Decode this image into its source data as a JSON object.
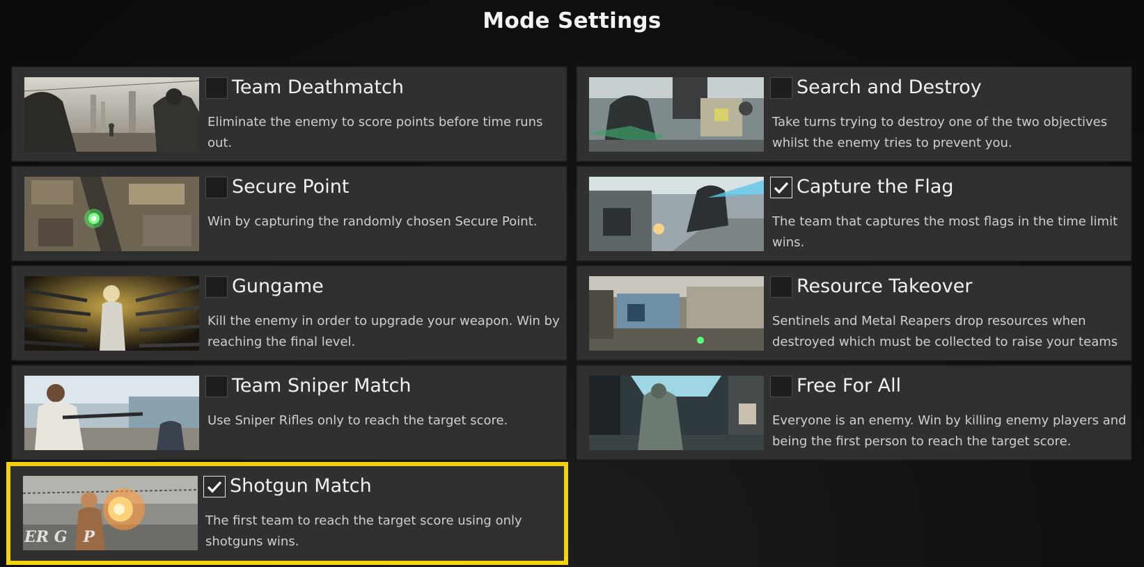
{
  "header": {
    "title": "Mode Settings"
  },
  "colors": {
    "card_bg": "#303030",
    "selected_outline": "#f3d20e",
    "text": "#f2f2f2"
  },
  "modes": [
    {
      "name": "Team Deathmatch",
      "description": "Eliminate the enemy to score points before time runs out.",
      "checked": false,
      "selected": false,
      "thumbnail": "soldiers-in-city-street-image"
    },
    {
      "name": "Search and Destroy",
      "description": "Take turns trying to destroy one of the two objectives whilst the enemy tries to prevent you.",
      "checked": false,
      "selected": false,
      "thumbnail": "armored-soldier-indoors-image"
    },
    {
      "name": "Secure Point",
      "description": "Win by capturing the randomly chosen Secure Point.",
      "checked": false,
      "selected": false,
      "thumbnail": "aerial-map-green-point-image"
    },
    {
      "name": "Capture the Flag",
      "description": "The team that captures the most flags in the time limit wins.",
      "checked": true,
      "selected": false,
      "thumbnail": "soldier-leaping-stairs-image"
    },
    {
      "name": "Gungame",
      "description": "Kill the enemy in order to upgrade your weapon. Win by reaching the final level.",
      "checked": false,
      "selected": false,
      "thumbnail": "character-with-weapon-rack-image"
    },
    {
      "name": "Resource Takeover",
      "description": "Sentinels and Metal Reapers drop resources when destroyed which must be collected to raise your teams",
      "checked": false,
      "selected": false,
      "thumbnail": "industrial-base-image"
    },
    {
      "name": "Team Sniper Match",
      "description": "Use Sniper Rifles only to reach the target score.",
      "checked": false,
      "selected": false,
      "thumbnail": "sniper-soldier-image"
    },
    {
      "name": "Free For All",
      "description": "Everyone is an enemy. Win by killing enemy players and being the first person to reach the target score.",
      "checked": false,
      "selected": false,
      "thumbnail": "soldier-in-station-image"
    },
    {
      "name": "Shotgun Match",
      "description": "The first team to reach the target score using only shotguns wins.",
      "checked": true,
      "selected": true,
      "thumbnail": "shotgun-blast-image",
      "thumbnail_caption": "ER G   P"
    }
  ]
}
